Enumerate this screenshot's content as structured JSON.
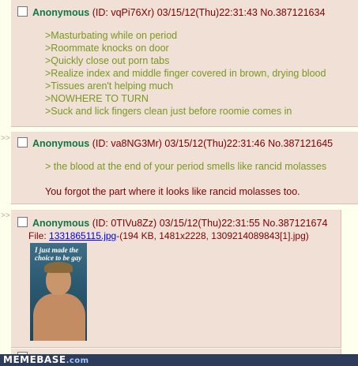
{
  "posts": [
    {
      "name": "Anonymous",
      "id": "(ID: vqPi76Xr)",
      "datetime": "03/15/12(Thu)22:31:43",
      "number": "No.387121634",
      "lines": [
        ">Masturbating while on period",
        ">Roommate knocks on door",
        ">Quickly close out porn tabs",
        ">Realize index and middle finger covered in brown, drying blood",
        ">Tissues aren't helping much",
        ">NOWHERE TO TURN",
        ">Suck and lick fingers clean just before roomie comes in"
      ]
    },
    {
      "arrows": ">>",
      "name": "Anonymous",
      "id": "(ID: va8NG3Mr)",
      "datetime": "03/15/12(Thu)22:31:46",
      "number": "No.387121645",
      "quote": "> the blood at the end of your period smells like rancid molasses",
      "reply": "You forgot the part where it looks like rancid molasses too."
    },
    {
      "arrows": ">>",
      "name": "Anonymous",
      "id": "(ID: 0TIVu8Zz)",
      "datetime": "03/15/12(Thu)22:31:55",
      "number": "No.387121674",
      "file_label": "File:",
      "file_link": "1331865115.jpg",
      "file_meta": "-(194 KB, 1481x2228, 1309214089843[1].jpg)",
      "thumb_caption": "I just made the choice to be gay"
    }
  ],
  "footer": {
    "logo": "MEMEBASE",
    "logo_suffix": ".com"
  },
  "colors": {
    "background": "#ffffee",
    "post_bg": "#f0e0d6",
    "name": "#117743",
    "greentext": "#789922",
    "text": "#800000",
    "link": "#0000ee"
  }
}
